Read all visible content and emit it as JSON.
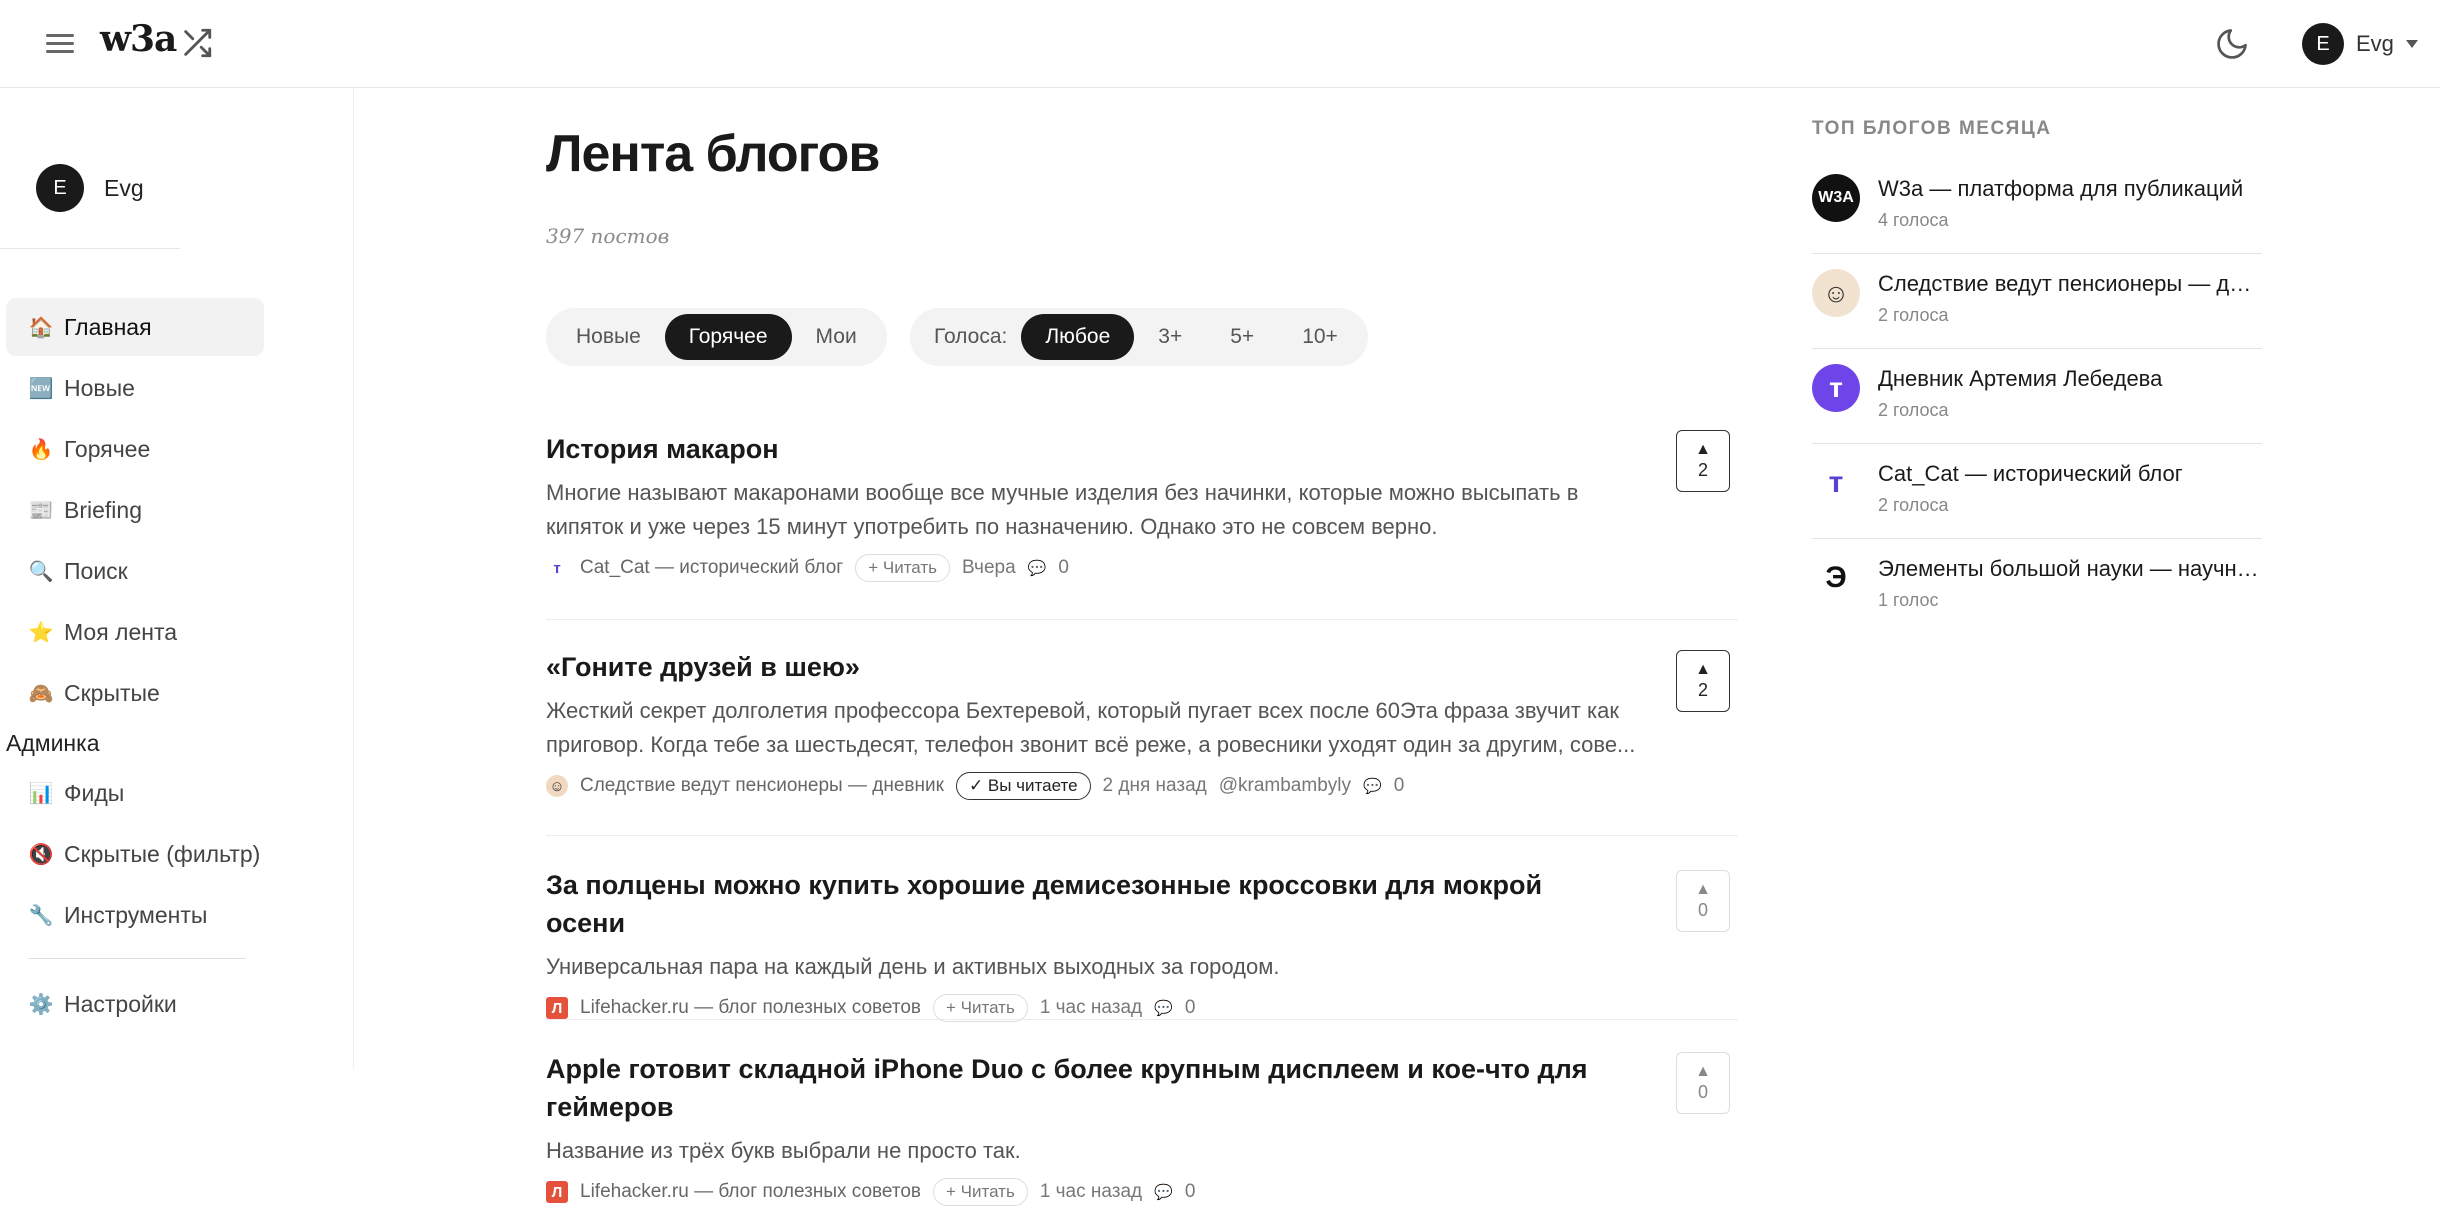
{
  "header": {
    "logo": "w3a",
    "user": {
      "initial": "E",
      "name": "Evg"
    }
  },
  "sidebar": {
    "user": {
      "initial": "E",
      "name": "Evg"
    },
    "items": [
      {
        "icon": "🏠",
        "label": "Главная"
      },
      {
        "icon": "🆕",
        "label": "Новые"
      },
      {
        "icon": "🔥",
        "label": "Горячее"
      },
      {
        "icon": "📰",
        "label": "Briefing"
      },
      {
        "icon": "🔍",
        "label": "Поиск"
      },
      {
        "icon": "⭐",
        "label": "Моя лента"
      },
      {
        "icon": "🙈",
        "label": "Скрытые"
      }
    ],
    "admin_label": "Админка",
    "admin_items": [
      {
        "icon": "📊",
        "label": "Фиды"
      },
      {
        "icon": "🔇",
        "label": "Скрытые (фильтр)"
      },
      {
        "icon": "🔧",
        "label": "Инструменты"
      }
    ],
    "settings": {
      "icon": "⚙️",
      "label": "Настройки"
    }
  },
  "main": {
    "title": "Лента блогов",
    "post_count": "397 постов",
    "sort_tabs": [
      "Новые",
      "Горячее",
      "Мои"
    ],
    "votes_label": "Голоса:",
    "vote_filters": [
      "Любое",
      "3+",
      "5+",
      "10+"
    ],
    "posts": [
      {
        "title": "История макарон",
        "description": "Многие называют макаронами вообще все мучные изделия без начинки, которые можно высыпать в кипяток и уже через 15 минут употребить по назначению. Однако это не совсем верно.",
        "source": "Cat_Cat — исторический блог",
        "action": "+ Читать",
        "time": "Вчера",
        "comments": "0",
        "votes": "2"
      },
      {
        "title": "«Гоните друзей в шею»",
        "description": "Жесткий секрет долголетия профессора Бехтеревой, который пугает всех после 60Эта фраза звучит как приговор. Когда тебе за шестьдесят, телефон звонит всё реже, а ровесники уходят один за другим, сове...",
        "source": "Следствие ведут пенсионеры — дневник",
        "action": "✓ Вы читаете",
        "time": "2 дня назад",
        "author": "@krambambyly",
        "comments": "0",
        "votes": "2"
      },
      {
        "title": "За полцены можно купить хорошие демисезонные кроссовки для мокрой осени",
        "description": "Универсальная пара на каждый день и активных выходных за городом.",
        "source": "Lifehacker.ru — блог полезных советов",
        "action": "+ Читать",
        "time": "1 час назад",
        "comments": "0",
        "votes": "0"
      },
      {
        "title": "Apple готовит складной iPhone Duo с более крупным дисплеем и кое-что для геймеров",
        "description": "Название из трёх букв выбрали не просто так.",
        "source": "Lifehacker.ru — блог полезных советов",
        "action": "+ Читать",
        "time": "1 час назад",
        "comments": "0",
        "votes": "0"
      }
    ]
  },
  "top_blogs": {
    "heading": "ТОП БЛОГОВ МЕСЯЦА",
    "items": [
      {
        "name": "W3a — платформа для публикаций",
        "votes": "4 голоса"
      },
      {
        "name": "Следствие ведут пенсионеры — дне...",
        "votes": "2 голоса"
      },
      {
        "name": "Дневник Артемия Лебедева",
        "votes": "2 голоса"
      },
      {
        "name": "Cat_Cat — исторический блог",
        "votes": "2 голоса"
      },
      {
        "name": "Элементы большой науки — научно...",
        "votes": "1 голос"
      }
    ]
  },
  "colors": {
    "accent_dark": "#1a1a1a",
    "lifehacker_red": "#e4523b",
    "cat_purple": "#5b3fd1",
    "lebedev_purple": "#6d45e8"
  },
  "icons": {
    "menu": "hamburger-icon",
    "random": "shuffle-icon",
    "theme": "moon-icon",
    "comment": "comment-icon",
    "vote": "upvote-arrow-icon"
  }
}
